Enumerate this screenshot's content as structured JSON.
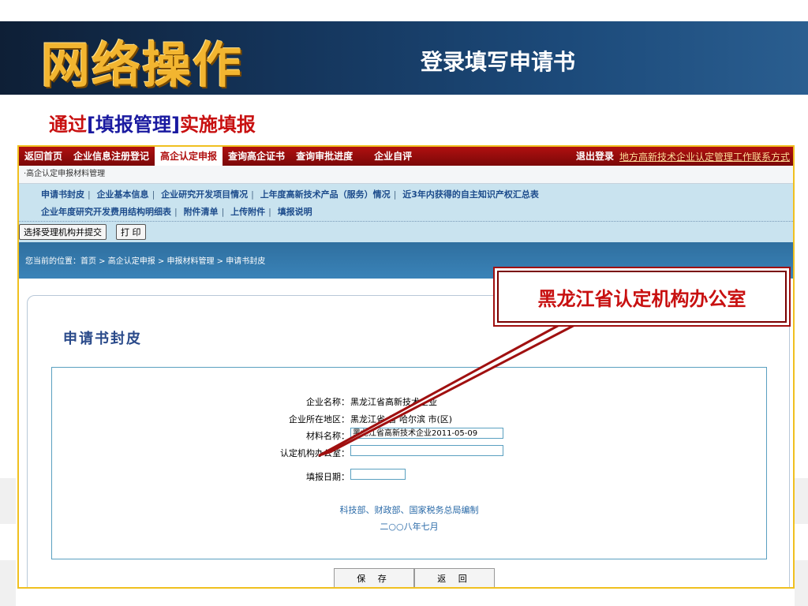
{
  "slide": {
    "big_title": "网络操作",
    "sub_title": "登录填写申请书",
    "caption_prefix": "通过",
    "caption_bracket": "[填报管理]",
    "caption_suffix": "实施填报",
    "callout": "黑龙江省认定机构办公室"
  },
  "nav": {
    "items": [
      "返回首页",
      "企业信息注册登记",
      "高企认定申报",
      "查询高企证书",
      "查询审批进度",
      "企业自评"
    ],
    "active_index": 2,
    "logout": "退出登录",
    "contact_link": "地方高新技术企业认定管理工作联系方式"
  },
  "breadcrumb_top": "·高企认定申报材料管理",
  "submenu": {
    "row1": [
      "申请书封皮",
      "企业基本信息",
      "企业研究开发项目情况",
      "上年度高新技术产品（服务）情况",
      "近3年内获得的自主知识产权汇总表"
    ],
    "row2": [
      "企业年度研究开发费用结构明细表",
      "附件清单",
      "上传附件",
      "填报说明"
    ],
    "separator": "|"
  },
  "actions": {
    "submit_label": "选择受理机构并提交",
    "print_label": "打 印"
  },
  "location_text": "您当前的位置：首页 > 高企认定申报 > 申报材料管理 > 申请书封皮",
  "page_heading": "申请书封皮",
  "form": {
    "company_name_label": "企业名称：",
    "company_name_value": "黑龙江省高新技术企业",
    "region_label": "企业所在地区：",
    "region_value": "黑龙江省 省 哈尔滨 市(区)",
    "material_label": "材料名称：",
    "material_value": "黑龙江省高新技术企业2011-05-09",
    "office_label": "认定机构办公室：",
    "office_value": "",
    "date_label": "填报日期：",
    "date_value": ""
  },
  "credits": {
    "line1": "科技部、财政部、国家税务总局编制",
    "line2": "二○○八年七月"
  },
  "buttons": {
    "save": "保 存",
    "back": "返 回"
  },
  "colors": {
    "header_bg": "#14345a",
    "title_gold": "#f2b530",
    "caption_red": "#c81010",
    "nav_red": "#b01010",
    "submenu_blue": "#c9e3ef",
    "frame_border": "#f0c020"
  }
}
